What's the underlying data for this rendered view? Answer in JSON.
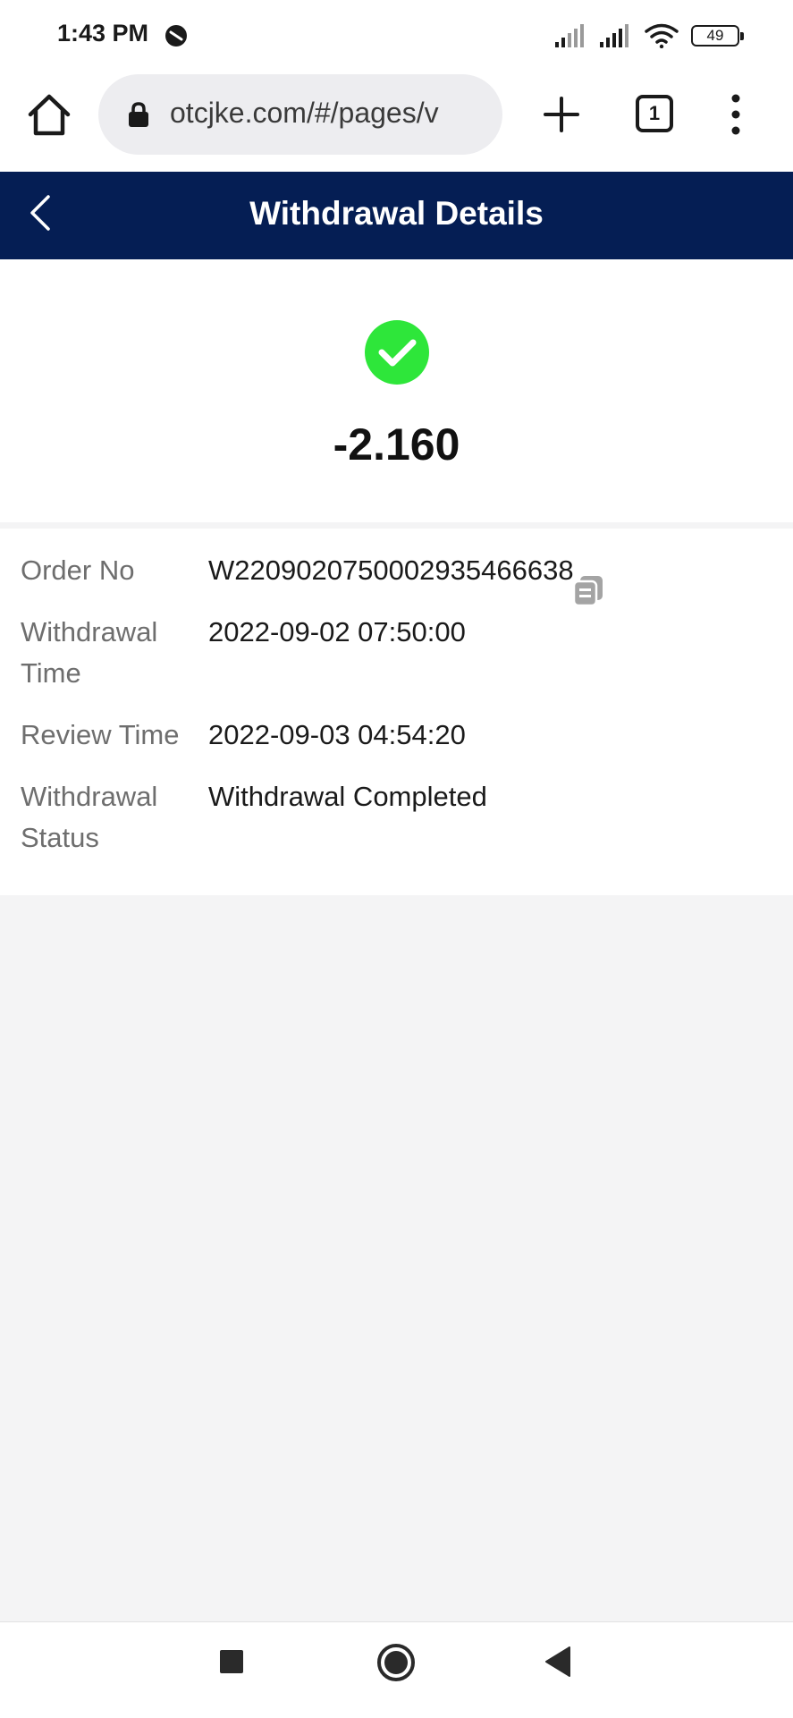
{
  "status_bar": {
    "time": "1:43 PM",
    "battery": "49"
  },
  "browser": {
    "url": "otcjke.com/#/pages/v",
    "tab_count": "1"
  },
  "header": {
    "title": "Withdrawal Details"
  },
  "summary": {
    "amount": "-2.160",
    "status_color": "#2ee63a"
  },
  "details": {
    "order_no_label": "Order No",
    "order_no_value": "W2209020750002935466638",
    "withdrawal_time_label_line1": "Withdrawal",
    "withdrawal_time_label_line2": "Time",
    "withdrawal_time_value": "2022-09-02 07:50:00",
    "review_time_label": "Review Time",
    "review_time_value": "2022-09-03 04:54:20",
    "withdrawal_status_label_line1": "Withdrawal",
    "withdrawal_status_label_line2": "Status",
    "withdrawal_status_value": "Withdrawal Completed"
  },
  "colors": {
    "header_bg": "#051e54",
    "page_bg": "#f4f4f5"
  }
}
